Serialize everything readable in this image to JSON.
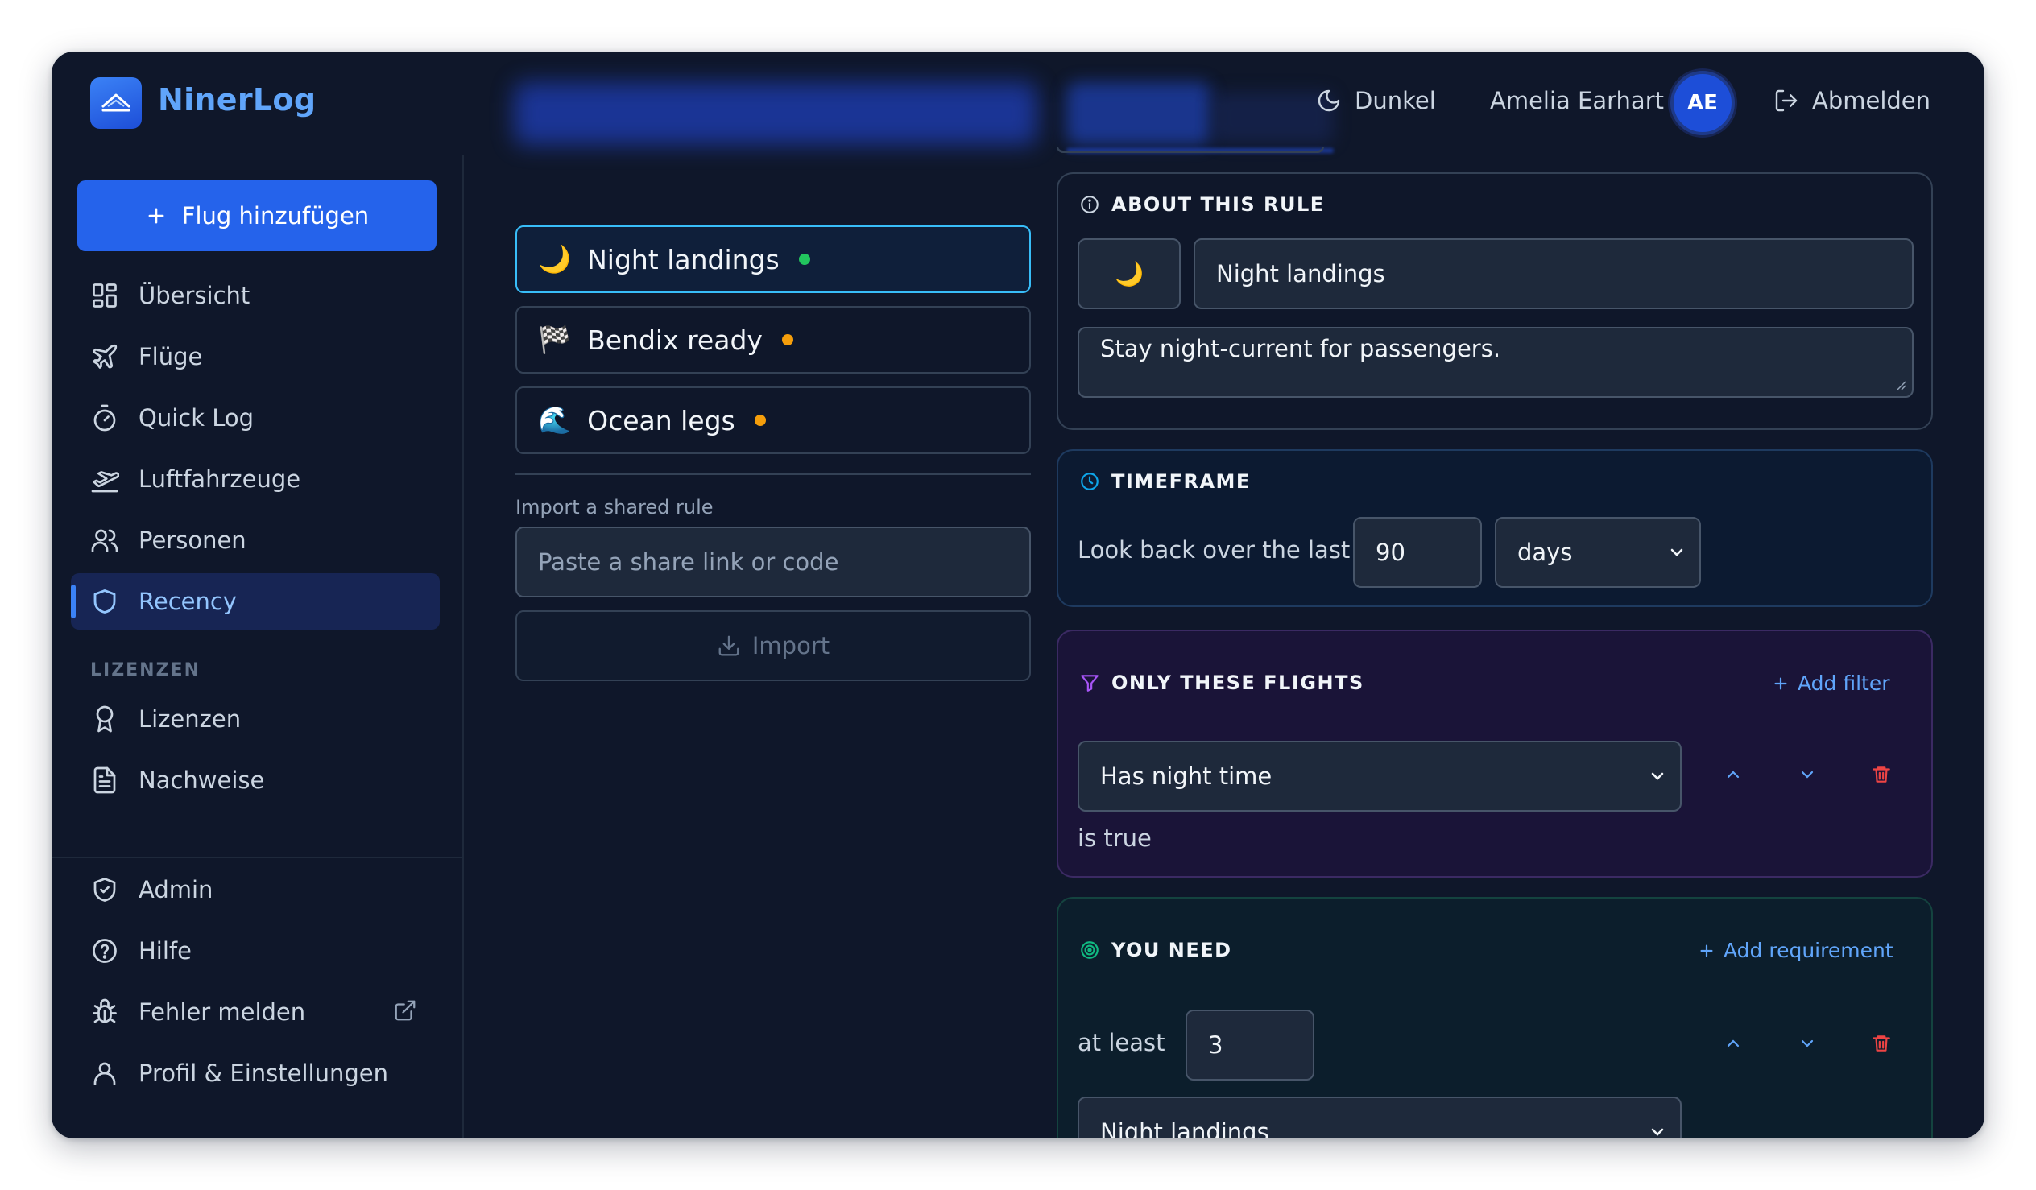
{
  "app": {
    "brand": "NinerLog"
  },
  "header": {
    "theme_label": "Dunkel",
    "user_name": "Amelia Earhart",
    "user_initials": "AE",
    "logout_label": "Abmelden"
  },
  "sidebar": {
    "add_flight_label": "Flug hinzufügen",
    "items": [
      {
        "label": "Übersicht",
        "icon": "grid-icon"
      },
      {
        "label": "Flüge",
        "icon": "plane-icon"
      },
      {
        "label": "Quick Log",
        "icon": "stopwatch-icon"
      },
      {
        "label": "Luftfahrzeuge",
        "icon": "plane-takeoff-icon"
      },
      {
        "label": "Personen",
        "icon": "users-icon"
      },
      {
        "label": "Recency",
        "icon": "shield-icon",
        "active": true
      }
    ],
    "section_label": "LIZENZEN",
    "license_items": [
      {
        "label": "Lizenzen",
        "icon": "award-icon"
      },
      {
        "label": "Nachweise",
        "icon": "document-icon"
      }
    ],
    "bottom_items": [
      {
        "label": "Admin",
        "icon": "shield-check-icon"
      },
      {
        "label": "Hilfe",
        "icon": "help-circle-icon"
      },
      {
        "label": "Fehler melden",
        "icon": "bug-icon",
        "external": true
      },
      {
        "label": "Profil & Einstellungen",
        "icon": "user-icon"
      }
    ]
  },
  "rules": {
    "items": [
      {
        "emoji": "🌙",
        "name": "Night landings",
        "status_color": "#22c55e",
        "selected": true
      },
      {
        "emoji": "🏁",
        "name": "Bendix ready",
        "status_color": "#f59e0b"
      },
      {
        "emoji": "🌊",
        "name": "Ocean legs",
        "status_color": "#f59e0b"
      }
    ],
    "import_label": "Import a shared rule",
    "import_placeholder": "Paste a share link or code",
    "import_button": "Import"
  },
  "editor": {
    "about": {
      "title": "ABOUT THIS RULE",
      "emoji": "🌙",
      "name": "Night landings",
      "description": "Stay night-current for passengers."
    },
    "timeframe": {
      "title": "TIMEFRAME",
      "lookback_label": "Look back over the last",
      "value": "90",
      "unit": "days",
      "accent": "#0ea5e9"
    },
    "filters": {
      "title": "ONLY THESE FLIGHTS",
      "add_label": "Add filter",
      "filter_field": "Has night time",
      "condition_text": "is true",
      "accent": "#a855f7"
    },
    "requirements": {
      "title": "YOU NEED",
      "add_label": "Add requirement",
      "at_least_label": "at least",
      "count": "3",
      "metric": "Night landings",
      "accent": "#10b981"
    }
  },
  "colors": {
    "primary": "#2563eb",
    "danger": "#ef4444",
    "background": "#0f172a"
  }
}
